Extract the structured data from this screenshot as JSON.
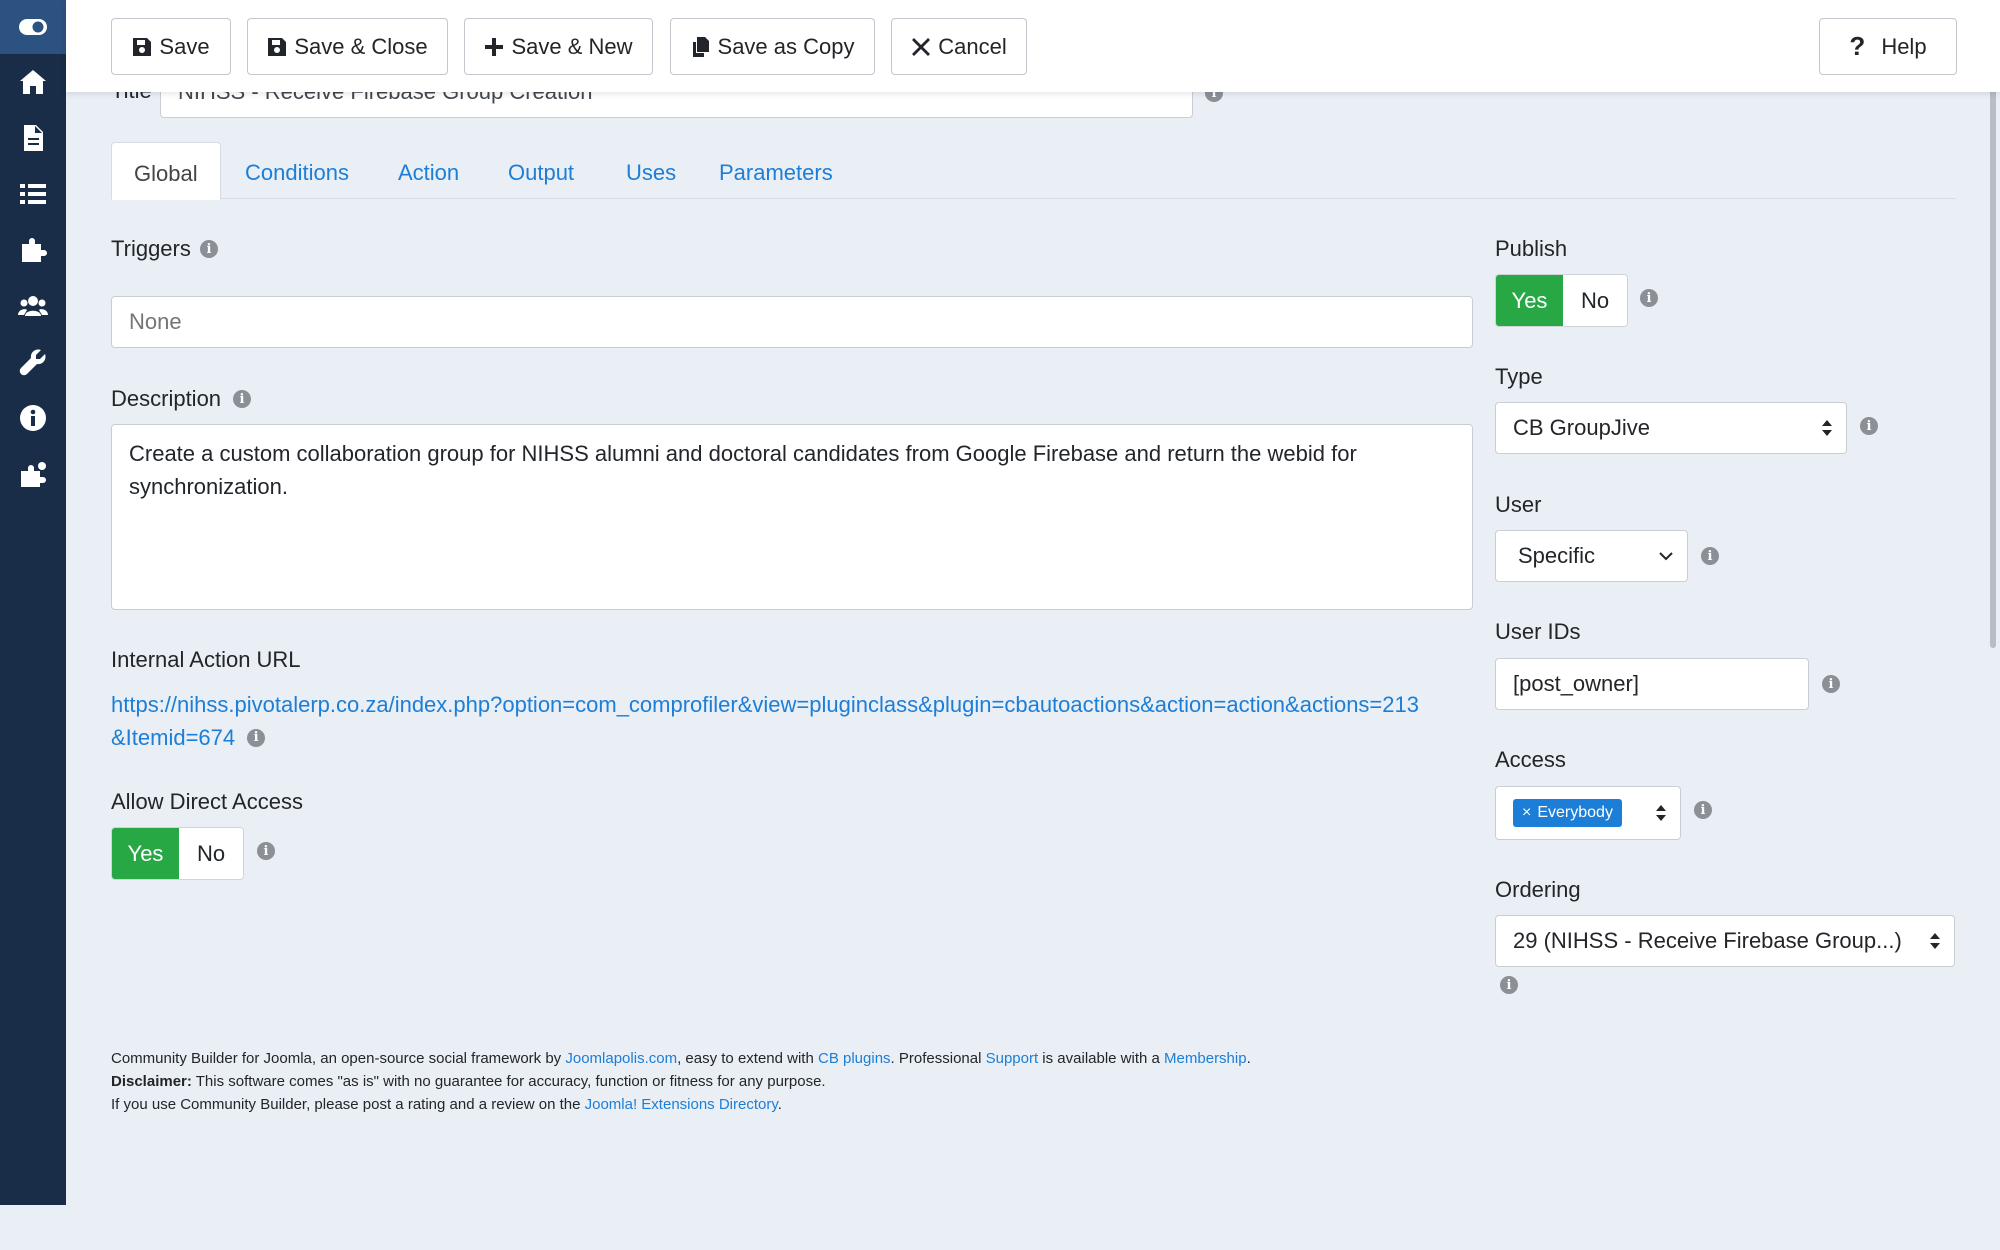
{
  "toolbar": {
    "save": "Save",
    "save_close": "Save & Close",
    "save_new": "Save & New",
    "save_copy": "Save as Copy",
    "cancel": "Cancel",
    "help": "Help"
  },
  "title": {
    "label": "Title",
    "value": "NIHSS - Receive Firebase Group Creation"
  },
  "tabs": [
    {
      "label": "Global",
      "active": true
    },
    {
      "label": "Conditions"
    },
    {
      "label": "Action"
    },
    {
      "label": "Output"
    },
    {
      "label": "Uses"
    },
    {
      "label": "Parameters"
    }
  ],
  "triggers": {
    "label": "Triggers",
    "placeholder": "None"
  },
  "description": {
    "label": "Description",
    "value": "Create a custom collaboration group for NIHSS alumni and doctoral candidates from Google Firebase and return the webid for synchronization."
  },
  "internal_url": {
    "label": "Internal Action URL",
    "line1": "https://nihss.pivotalerp.co.za/index.php?option=com_comprofiler&view=pluginclass&plugin=cbautoactions&action=action&actions=213",
    "line2": "&Itemid=674"
  },
  "direct_access": {
    "label": "Allow Direct Access",
    "yes": "Yes",
    "no": "No",
    "value": "Yes"
  },
  "publish": {
    "label": "Publish",
    "yes": "Yes",
    "no": "No",
    "value": "Yes"
  },
  "type": {
    "label": "Type",
    "value": "CB GroupJive"
  },
  "user": {
    "label": "User",
    "value": "Specific"
  },
  "user_ids": {
    "label": "User IDs",
    "value": "[post_owner]"
  },
  "access": {
    "label": "Access",
    "tag": "Everybody",
    "tag_remove": "×"
  },
  "ordering": {
    "label": "Ordering",
    "value": "29 (NIHSS - Receive Firebase Group...)"
  },
  "footer": {
    "l1_a": "Community Builder for Joomla, an open-source social framework by ",
    "l1_link1": "Joomlapolis.com",
    "l1_b": ", easy to extend with ",
    "l1_link2": "CB plugins",
    "l1_c": ". Professional ",
    "l1_link3": "Support",
    "l1_d": " is available with a ",
    "l1_link4": "Membership",
    "l1_e": ".",
    "l2_bold": "Disclaimer:",
    "l2_text": " This software comes \"as is\" with no guarantee for accuracy, function or fitness for any purpose.",
    "l3_a": "If you use Community Builder, please post a rating and a review on the ",
    "l3_link": "Joomla! Extensions Directory",
    "l3_b": "."
  },
  "colors": {
    "sidebar": "#1a2d48",
    "toggle_on": "#28a745",
    "link": "#1c7ed6",
    "tag": "#1c7ed6"
  }
}
